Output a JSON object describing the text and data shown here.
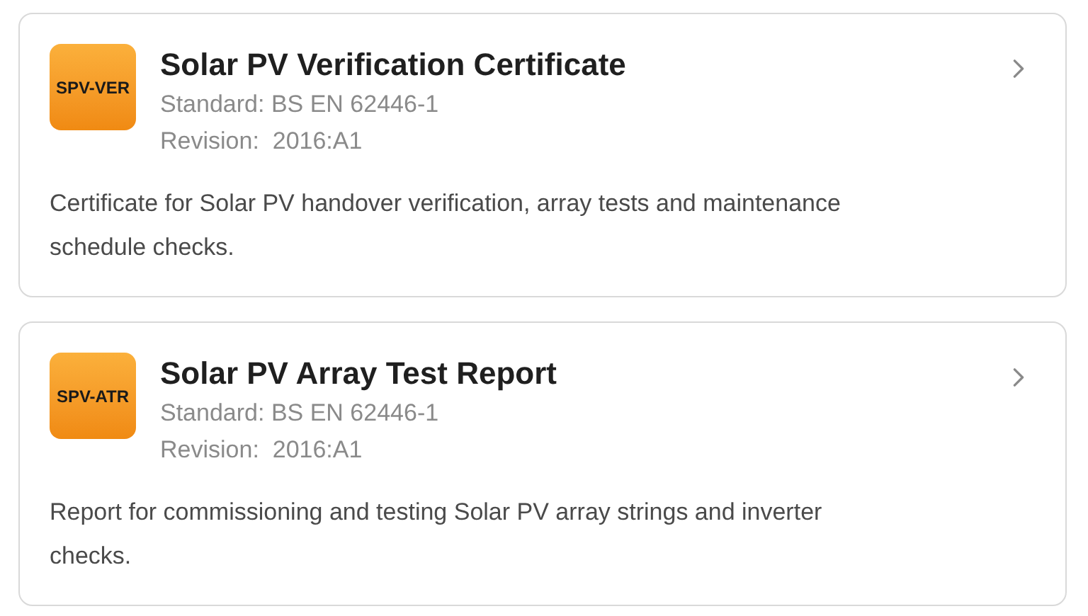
{
  "cards": [
    {
      "badge": "SPV-VER",
      "title": "Solar PV Verification Certificate",
      "standard": "Standard: BS EN 62446-1",
      "revision": "Revision:  2016:A1",
      "description": "Certificate for Solar PV handover verification, array tests and maintenance schedule checks."
    },
    {
      "badge": "SPV-ATR",
      "title": "Solar PV Array Test Report",
      "standard": "Standard: BS EN 62446-1",
      "revision": "Revision:  2016:A1",
      "description": "Report for commissioning and testing Solar PV array strings and inverter checks."
    }
  ]
}
